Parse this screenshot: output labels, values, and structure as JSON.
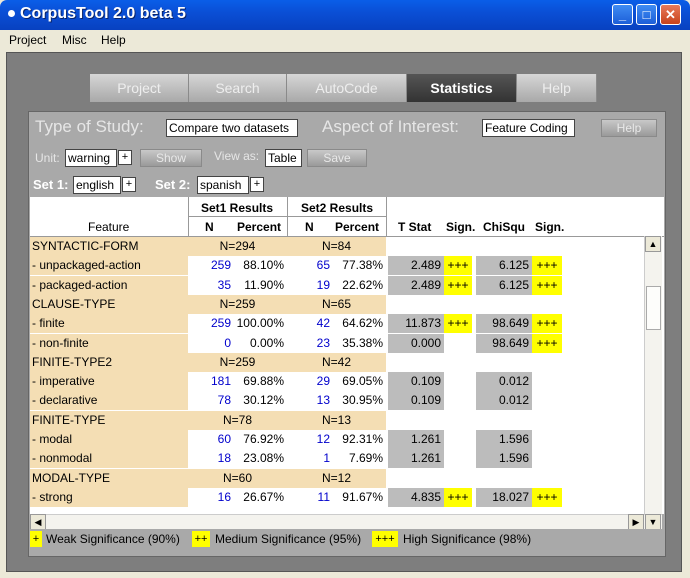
{
  "window": {
    "title": "CorpusTool 2.0 beta 5",
    "minimize": "_",
    "maximize": "□",
    "close": "✕"
  },
  "menu": [
    "Project",
    "Misc",
    "Help"
  ],
  "tabs": [
    {
      "label": "Project",
      "active": false
    },
    {
      "label": "Search",
      "active": false
    },
    {
      "label": "AutoCode",
      "active": false
    },
    {
      "label": "Statistics",
      "active": true
    },
    {
      "label": "Help",
      "active": false
    }
  ],
  "study": {
    "type_label": "Type of Study:",
    "type_value": "Compare two datasets",
    "aspect_label": "Aspect of Interest:",
    "aspect_value": "Feature Coding",
    "help_button": "Help"
  },
  "controls": {
    "unit_label": "Unit:",
    "unit_value": "warning",
    "plus": "+",
    "show_button": "Show",
    "view_label": "View as:",
    "view_value": "Table",
    "save_button": "Save"
  },
  "sets": {
    "set1_label": "Set 1:",
    "set1_value": "english",
    "set2_label": "Set 2:",
    "set2_value": "spanish"
  },
  "table": {
    "group_headers": {
      "set1": "Set1 Results",
      "set2": "Set2 Results"
    },
    "columns": {
      "feature": "Feature",
      "n": "N",
      "percent": "Percent",
      "tstat": "T Stat",
      "sign": "Sign.",
      "chisq": "ChiSqu",
      "sign2": "Sign."
    },
    "rows": [
      {
        "kind": "cat",
        "feature": "SYNTACTIC-FORM",
        "n1": "N=294",
        "n2": "N=84"
      },
      {
        "kind": "item",
        "feature": " - unpackaged-action",
        "n1": "259",
        "p1": "88.10%",
        "n2": "65",
        "p2": "77.38%",
        "t": "2.489",
        "ts": "+++",
        "c": "6.125",
        "cs": "+++"
      },
      {
        "kind": "item",
        "feature": " - packaged-action",
        "n1": "35",
        "p1": "11.90%",
        "n2": "19",
        "p2": "22.62%",
        "t": "2.489",
        "ts": "+++",
        "c": "6.125",
        "cs": "+++"
      },
      {
        "kind": "cat",
        "feature": "CLAUSE-TYPE",
        "n1": "N=259",
        "n2": "N=65"
      },
      {
        "kind": "item",
        "feature": " - finite",
        "n1": "259",
        "p1": "100.00%",
        "n2": "42",
        "p2": "64.62%",
        "t": "11.873",
        "ts": "+++",
        "c": "98.649",
        "cs": "+++"
      },
      {
        "kind": "item",
        "feature": " - non-finite",
        "n1": "0",
        "p1": "0.00%",
        "n2": "23",
        "p2": "35.38%",
        "t": "0.000",
        "ts": "",
        "c": "98.649",
        "cs": "+++"
      },
      {
        "kind": "cat",
        "feature": "FINITE-TYPE2",
        "n1": "N=259",
        "n2": "N=42"
      },
      {
        "kind": "item",
        "feature": " - imperative",
        "n1": "181",
        "p1": "69.88%",
        "n2": "29",
        "p2": "69.05%",
        "t": "0.109",
        "ts": "",
        "c": "0.012",
        "cs": ""
      },
      {
        "kind": "item",
        "feature": " - declarative",
        "n1": "78",
        "p1": "30.12%",
        "n2": "13",
        "p2": "30.95%",
        "t": "0.109",
        "ts": "",
        "c": "0.012",
        "cs": ""
      },
      {
        "kind": "cat",
        "feature": "FINITE-TYPE",
        "n1": "N=78",
        "n2": "N=13"
      },
      {
        "kind": "item",
        "feature": " - modal",
        "n1": "60",
        "p1": "76.92%",
        "n2": "12",
        "p2": "92.31%",
        "t": "1.261",
        "ts": "",
        "c": "1.596",
        "cs": ""
      },
      {
        "kind": "item",
        "feature": " - nonmodal",
        "n1": "18",
        "p1": "23.08%",
        "n2": "1",
        "p2": "7.69%",
        "t": "1.261",
        "ts": "",
        "c": "1.596",
        "cs": ""
      },
      {
        "kind": "cat",
        "feature": "MODAL-TYPE",
        "n1": "N=60",
        "n2": "N=12"
      },
      {
        "kind": "item",
        "feature": " - strong",
        "n1": "16",
        "p1": "26.67%",
        "n2": "11",
        "p2": "91.67%",
        "t": "4.835",
        "ts": "+++",
        "c": "18.027",
        "cs": "+++"
      }
    ]
  },
  "legend": [
    {
      "symbol": "+",
      "text": "Weak Significance (90%)"
    },
    {
      "symbol": "++",
      "text": "Medium Significance (95%)"
    },
    {
      "symbol": "+++",
      "text": "High Significance (98%)"
    }
  ]
}
